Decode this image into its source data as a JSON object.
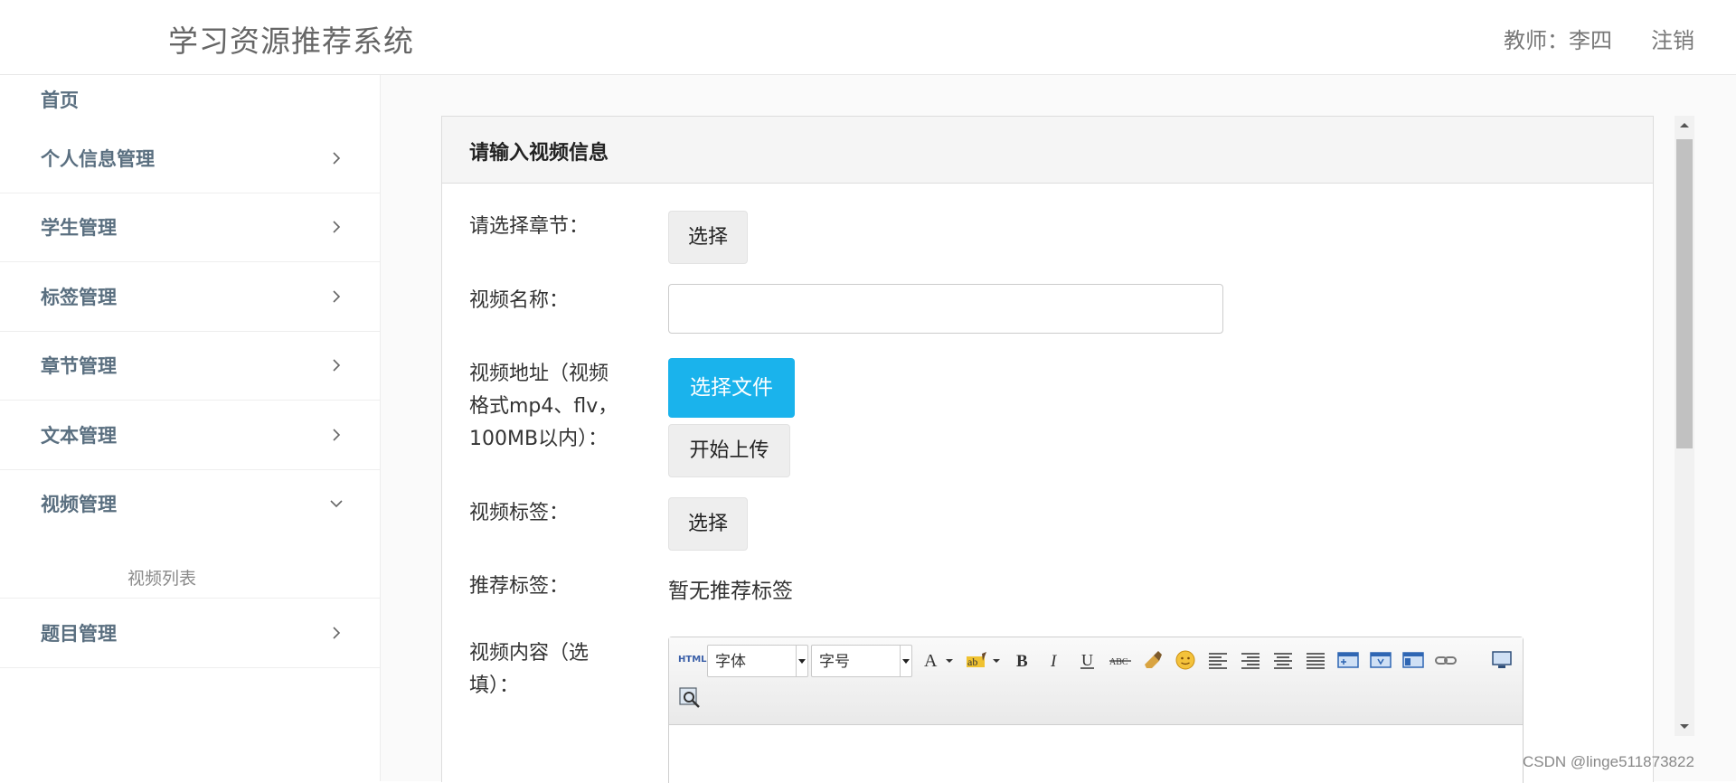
{
  "header": {
    "app_title": "学习资源推荐系统",
    "user_label": "教师：李四",
    "logout_label": "注销"
  },
  "sidebar": {
    "items": [
      {
        "label": "首页"
      },
      {
        "label": "个人信息管理",
        "icon": "chevron-right-icon"
      },
      {
        "label": "学生管理",
        "icon": "chevron-right-icon"
      },
      {
        "label": "标签管理",
        "icon": "chevron-right-icon"
      },
      {
        "label": "章节管理",
        "icon": "chevron-right-icon"
      },
      {
        "label": "文本管理",
        "icon": "chevron-right-icon"
      },
      {
        "label": "视频管理",
        "icon": "chevron-down-icon",
        "expanded": true,
        "children": [
          {
            "label": "视频列表"
          }
        ]
      },
      {
        "label": "题目管理",
        "icon": "chevron-right-icon"
      }
    ]
  },
  "panel": {
    "title": "请输入视频信息"
  },
  "form": {
    "chapter_label": "请选择章节：",
    "chapter_button": "选择",
    "name_label": "视频名称：",
    "name_value": "",
    "address_label_line1": "视频地址（视频",
    "address_label_line2": "格式mp4、flv，",
    "address_label_line3": "100MB以内）：",
    "choose_file_button": "选择文件",
    "start_upload_button": "开始上传",
    "tags_label": "视频标签：",
    "tags_button": "选择",
    "recommend_label": "推荐标签：",
    "recommend_value": "暂无推荐标签",
    "content_label_line1": "视频内容（选",
    "content_label_line2": "填）："
  },
  "editor": {
    "html_label": "HTML",
    "font_family_select": "字体",
    "font_size_select": "字号",
    "tools": [
      "font-color-icon",
      "highlight-icon",
      "bold-icon",
      "italic-icon",
      "underline-icon",
      "strikethrough-icon",
      "clear-format-icon",
      "emoticon-icon",
      "align-left-icon",
      "align-right-icon",
      "align-center-icon",
      "justify-icon",
      "image-icon",
      "flash-icon",
      "media-icon",
      "link-icon",
      "fullscreen-icon",
      "preview-icon"
    ]
  },
  "colors": {
    "accent_blue": "#1ab3ec",
    "sidebar_text": "#5a6f80"
  },
  "watermark": "CSDN @linge511873822"
}
